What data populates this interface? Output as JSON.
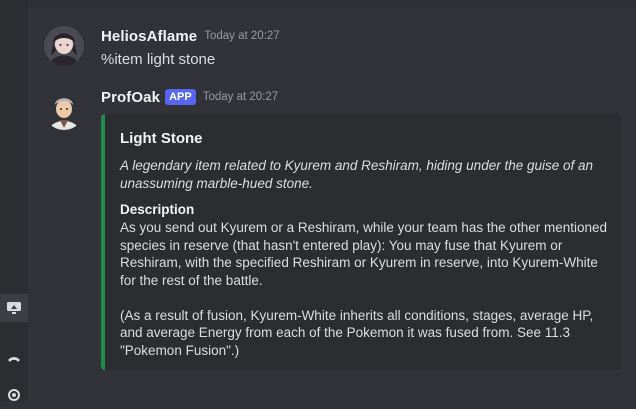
{
  "messages": [
    {
      "username": "HeliosAflame",
      "timestamp": "Today at 20:27",
      "text": "%item light stone"
    },
    {
      "username": "ProfOak",
      "badge": "APP",
      "timestamp": "Today at 20:27",
      "embed": {
        "accent_color": "#1f8b4c",
        "title": "Light Stone",
        "description": "A legendary item related to Kyurem and Reshiram, hiding under the guise of an unassuming marble-hued stone.",
        "field_name": "Description",
        "field_value": "As you send out Kyurem or a Reshiram, while your team has the other mentioned species in reserve (that hasn't entered play): You may fuse that Kyurem or Reshiram, with the specified Reshiram or Kyurem in reserve, into Kyurem-White for the rest of the battle.\n\n(As a result of fusion, Kyurem-White inherits all conditions, stages, average HP, and average Energy from each of the Pokemon it was fused from. See 11.3 \"Pokemon Fusion\".)"
      }
    }
  ],
  "sidebar_icons": [
    "screen-share-icon",
    "phone-icon",
    "settings-icon"
  ],
  "colors": {
    "background": "#323339",
    "embed_background": "#2b2d31",
    "app_badge": "#5865f2",
    "embed_accent": "#1f8b4c"
  }
}
